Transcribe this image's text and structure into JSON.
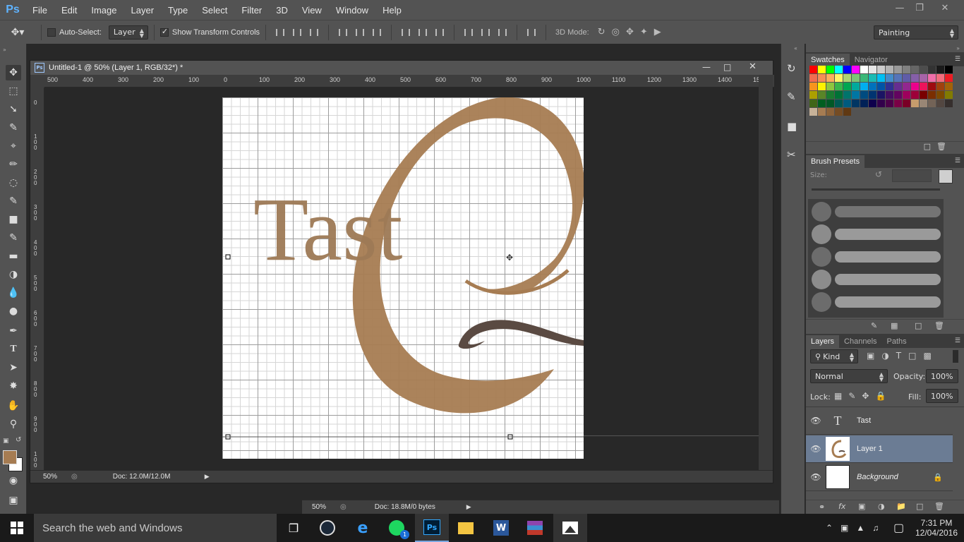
{
  "app": {
    "logo": "Ps",
    "menu": [
      "File",
      "Edit",
      "Image",
      "Layer",
      "Type",
      "Select",
      "Filter",
      "3D",
      "View",
      "Window",
      "Help"
    ],
    "window_controls": [
      "minimize",
      "restore",
      "close"
    ]
  },
  "options_bar": {
    "auto_select_label": "Auto-Select:",
    "auto_select_value": "Layer",
    "show_transform_label": "Show Transform Controls",
    "mode_3d_label": "3D Mode:",
    "workspace": "Painting"
  },
  "document": {
    "title": "Untitled-1 @ 50% (Layer 1, RGB/32*) *",
    "zoom": "50%",
    "doc_info": "Doc: 12.0M/12.0M",
    "ruler_h": [
      "500",
      "400",
      "300",
      "200",
      "100",
      "0",
      "100",
      "200",
      "300",
      "400",
      "500",
      "600",
      "700",
      "800",
      "900",
      "1000",
      "1100",
      "1200",
      "1300",
      "1400",
      "15"
    ],
    "ruler_v": [
      "0",
      "100",
      "200",
      "300",
      "400",
      "500",
      "600",
      "700",
      "800",
      "900",
      "100"
    ],
    "canvas_text": "Tast"
  },
  "background_document": {
    "zoom": "50%",
    "doc_info": "Doc: 18.8M/0 bytes"
  },
  "panels": {
    "swatches_tab": "Swatches",
    "navigator_tab": "Navigator",
    "brush_presets_tab": "Brush Presets",
    "brush_size_label": "Size:",
    "layers_tab": "Layers",
    "channels_tab": "Channels",
    "paths_tab": "Paths",
    "kind_label": "Kind",
    "blend_mode": "Normal",
    "opacity_label": "Opacity:",
    "opacity_value": "100%",
    "lock_label": "Lock:",
    "fill_label": "Fill:",
    "fill_value": "100%",
    "layers": [
      {
        "name": "Tast",
        "type": "text"
      },
      {
        "name": "Layer 1",
        "type": "image",
        "selected": true
      },
      {
        "name": "Background",
        "type": "background",
        "locked": true
      }
    ]
  },
  "swatch_colors": [
    "#ff0000",
    "#ffff00",
    "#00ff00",
    "#00ffff",
    "#0000ff",
    "#ff00ff",
    "#ffffff",
    "#e6e6e6",
    "#cccccc",
    "#b3b3b3",
    "#999999",
    "#808080",
    "#666666",
    "#4d4d4d",
    "#333333",
    "#1a1a1a",
    "#000000",
    "#f26c4f",
    "#f68e55",
    "#fbaf5c",
    "#fff467",
    "#acd372",
    "#7cc576",
    "#3bb878",
    "#1abbb4",
    "#00bff3",
    "#438ccb",
    "#5574b9",
    "#605ca8",
    "#855fa8",
    "#a763a8",
    "#f06ea9",
    "#f26d7d",
    "#ed1c24",
    "#f7941d",
    "#fff200",
    "#8dc63f",
    "#39b54a",
    "#00a651",
    "#00a99d",
    "#00aeef",
    "#0072bc",
    "#0054a6",
    "#2e3192",
    "#662d91",
    "#92278f",
    "#ec008c",
    "#ed145b",
    "#9e0b0f",
    "#a0410d",
    "#a36209",
    "#aba000",
    "#598527",
    "#1a7b30",
    "#007236",
    "#00746b",
    "#0076a3",
    "#004b80",
    "#003471",
    "#1b1464",
    "#440e62",
    "#630460",
    "#9e005d",
    "#9e0039",
    "#790000",
    "#7b2e00",
    "#7d4900",
    "#827b00",
    "#406618",
    "#005e20",
    "#005826",
    "#005952",
    "#005b7f",
    "#003663",
    "#002157",
    "#0d004c",
    "#32004b",
    "#4b0049",
    "#7b0046",
    "#7a0026",
    "#c69c6d",
    "#998675",
    "#736357",
    "#534741",
    "#362f2d",
    "#c7b299",
    "#a67c52",
    "#8c6239",
    "#754c24",
    "#603913"
  ],
  "taskbar": {
    "search_placeholder": "Search the web and Windows",
    "time": "7:31 PM",
    "date": "12/04/2016",
    "spotify_badge": "1"
  },
  "colors": {
    "accent_brown": "#a67c52",
    "foreground_color": "#a67c52",
    "background_color": "#ffffff"
  }
}
